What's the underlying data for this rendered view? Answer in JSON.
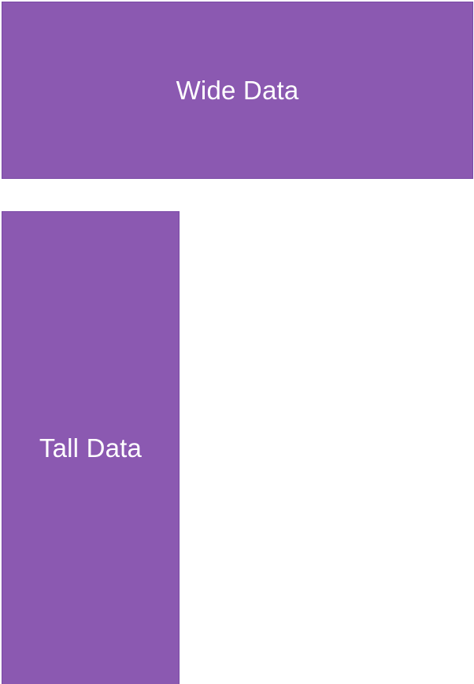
{
  "colors": {
    "block_fill": "#8b59b1",
    "block_border": "#7a4aa6",
    "label": "#ffffff",
    "background": "#ffffff"
  },
  "blocks": {
    "wide": {
      "label": "Wide Data"
    },
    "tall": {
      "label": "Tall Data"
    }
  }
}
